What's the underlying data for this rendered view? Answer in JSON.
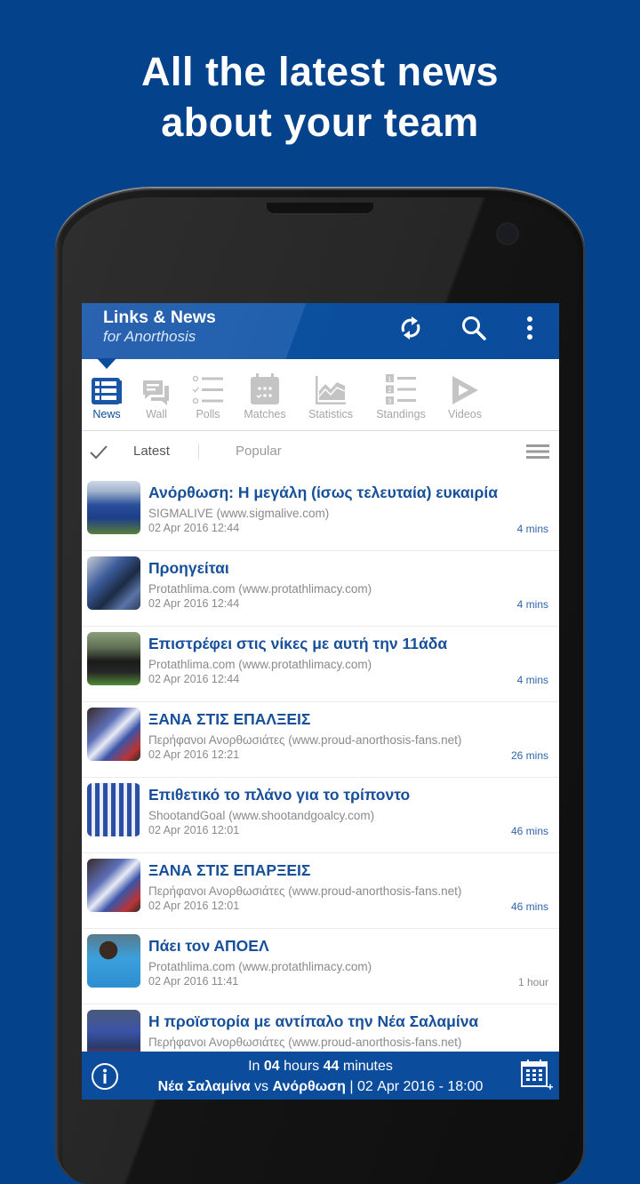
{
  "promo": {
    "line1": "All the latest news",
    "line2": "about your team"
  },
  "colors": {
    "brand_blue": "#0b4c9c",
    "background": "#04428c",
    "headline": "#174f9b",
    "inactive_icon": "#c4c4c4"
  },
  "appbar": {
    "title": "Links & News",
    "subtitle": "for Anorthosis",
    "actions": [
      {
        "icon": "refresh-icon"
      },
      {
        "icon": "search-icon"
      },
      {
        "icon": "more-vertical-icon"
      }
    ]
  },
  "tabs": [
    {
      "label": "News",
      "icon": "news-icon",
      "active": true
    },
    {
      "label": "Wall",
      "icon": "chat-icon",
      "active": false
    },
    {
      "label": "Polls",
      "icon": "poll-list-icon",
      "active": false
    },
    {
      "label": "Matches",
      "icon": "calendar-icon",
      "active": false
    },
    {
      "label": "Statistics",
      "icon": "chart-icon",
      "active": false
    },
    {
      "label": "Standings",
      "icon": "numbered-list-icon",
      "active": false
    },
    {
      "label": "Videos",
      "icon": "play-icon",
      "active": false
    }
  ],
  "filter": {
    "latest": "Latest",
    "popular": "Popular",
    "selected": "Latest"
  },
  "news": [
    {
      "headline": "Ανόρθωση: Η μεγάλη (ίσως τελευταία) ευκαιρία",
      "source": "SIGMALIVE (www.sigmalive.com)",
      "date": "02 Apr 2016 12:44",
      "ago": "4 mins"
    },
    {
      "headline": "Προηγείται",
      "source": "Protathlima.com (www.protathlimacy.com)",
      "date": "02 Apr 2016 12:44",
      "ago": "4 mins"
    },
    {
      "headline": "Επιστρέφει στις νίκες με αυτή την 11άδα",
      "source": "Protathlima.com (www.protathlimacy.com)",
      "date": "02 Apr 2016 12:44",
      "ago": "4 mins"
    },
    {
      "headline": "ΞΑΝΑ ΣΤΙΣ ΕΠΑΛΞΕΙΣ",
      "source": "Περήφανοι Ανορθωσιάτες (www.proud-anorthosis-fans.net)",
      "date": "02 Apr 2016 12:21",
      "ago": "26 mins"
    },
    {
      "headline": "Επιθετικό το πλάνο για το τρίποντο",
      "source": "ShootandGoal (www.shootandgoalcy.com)",
      "date": "02 Apr 2016 12:01",
      "ago": "46 mins"
    },
    {
      "headline": "ΞΑΝΑ ΣΤΙΣ ΕΠΑΡΞΕΙΣ",
      "source": "Περήφανοι Ανορθωσιάτες (www.proud-anorthosis-fans.net)",
      "date": "02 Apr 2016 12:01",
      "ago": "46 mins"
    },
    {
      "headline": "Πάει τον ΑΠΟΕΛ",
      "source": "Protathlima.com (www.protathlimacy.com)",
      "date": "02 Apr 2016 11:41",
      "ago": "1 hour"
    },
    {
      "headline": "Η προϊστορία με αντίπαλο την Νέα Σαλαμίνα",
      "source": "Περήφανοι Ανορθωσιάτες (www.proud-anorthosis-fans.net)",
      "date": "",
      "ago": ""
    }
  ],
  "footer": {
    "in": "In",
    "hours_value": "04",
    "hours_label": "hours",
    "minutes_value": "44",
    "minutes_label": "minutes",
    "home_team": "Νέα Σαλαμίνα",
    "vs": "vs",
    "away_team": "Ανόρθωση",
    "datetime": "| 02 Apr 2016 - 18:00"
  }
}
